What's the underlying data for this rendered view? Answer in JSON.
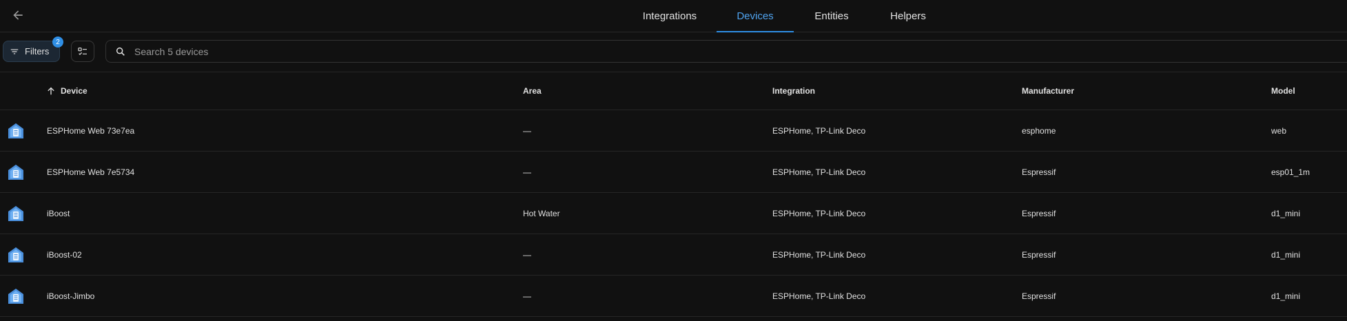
{
  "header": {
    "tabs": [
      {
        "label": "Integrations",
        "active": false
      },
      {
        "label": "Devices",
        "active": true
      },
      {
        "label": "Entities",
        "active": false
      },
      {
        "label": "Helpers",
        "active": false
      }
    ]
  },
  "toolbar": {
    "filters_label": "Filters",
    "filters_count": "2",
    "search_placeholder": "Search 5 devices"
  },
  "table": {
    "columns": {
      "device": "Device",
      "area": "Area",
      "integration": "Integration",
      "manufacturer": "Manufacturer",
      "model": "Model"
    },
    "rows": [
      {
        "device": "ESPHome Web 73e7ea",
        "area": "—",
        "integration": "ESPHome, TP-Link Deco",
        "manufacturer": "esphome",
        "model": "web"
      },
      {
        "device": "ESPHome Web 7e5734",
        "area": "—",
        "integration": "ESPHome, TP-Link Deco",
        "manufacturer": "Espressif",
        "model": "esp01_1m"
      },
      {
        "device": "iBoost",
        "area": "Hot Water",
        "integration": "ESPHome, TP-Link Deco",
        "manufacturer": "Espressif",
        "model": "d1_mini"
      },
      {
        "device": "iBoost-02",
        "area": "—",
        "integration": "ESPHome, TP-Link Deco",
        "manufacturer": "Espressif",
        "model": "d1_mini"
      },
      {
        "device": "iBoost-Jimbo",
        "area": "—",
        "integration": "ESPHome, TP-Link Deco",
        "manufacturer": "Espressif",
        "model": "d1_mini"
      }
    ]
  },
  "colors": {
    "accent": "#2f8fe6",
    "active_tab_text": "#4fa3ef",
    "background": "#111111"
  },
  "icons": {
    "back": "arrow-left-icon",
    "filter": "filter-icon",
    "select_mode": "select-mode-icon",
    "search": "search-icon",
    "sort": "arrow-up-icon",
    "device": "esphome-house-icon"
  }
}
